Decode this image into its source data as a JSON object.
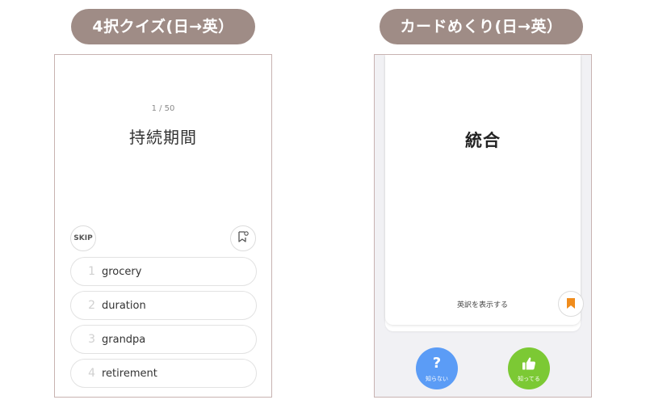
{
  "sections": {
    "quiz_title": "4択クイズ(日→英）",
    "card_title": "カードめくり(日→英）"
  },
  "quiz": {
    "progress": "1 / 50",
    "question": "持続期間",
    "skip_label": "SKIP",
    "bookmark_icon": "bookmark-add-icon",
    "options": [
      {
        "number": "1",
        "word": "grocery"
      },
      {
        "number": "2",
        "word": "duration"
      },
      {
        "number": "3",
        "word": "grandpa"
      },
      {
        "number": "4",
        "word": "retirement"
      }
    ]
  },
  "card": {
    "term": "統合",
    "show_translation_label": "英訳を表示する",
    "bookmark_icon": "bookmark-icon",
    "unknown_glyph": "?",
    "unknown_label": "知らない",
    "known_icon": "thumbs-up-icon",
    "known_label": "知ってる"
  },
  "colors": {
    "pill": "#9f8c86",
    "frame_border": "#c8b3b1",
    "bookmark_orange": "#f08c1c",
    "unknown_blue": "#5b9cf6",
    "known_green": "#7cc934"
  }
}
